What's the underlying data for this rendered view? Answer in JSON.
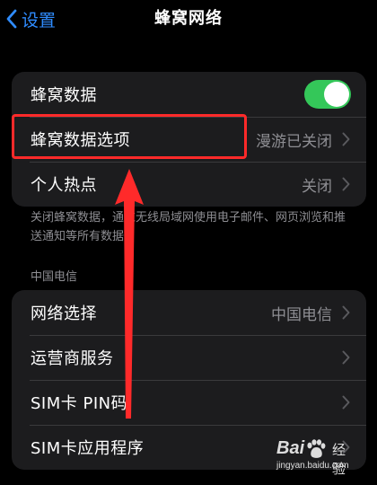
{
  "nav": {
    "back_label": "设置",
    "title": "蜂窝网络"
  },
  "group1": {
    "rows": [
      {
        "label": "蜂窝数据",
        "toggle_on": true
      },
      {
        "label": "蜂窝数据选项",
        "value": "漫游已关闭"
      },
      {
        "label": "个人热点",
        "value": "关闭"
      }
    ]
  },
  "footnote": "关闭蜂窝数据，通过无线局域网使用电子邮件、网页浏览和推送通知等所有数据。",
  "section2": {
    "header": "中国电信",
    "rows": [
      {
        "label": "网络选择",
        "value": "中国电信"
      },
      {
        "label": "运营商服务"
      },
      {
        "label": "SIM卡 PIN码"
      },
      {
        "label": "SIM卡应用程序"
      }
    ]
  },
  "annotation": {
    "highlight_color": "#ff2a2a",
    "arrow_color": "#ff2a2a"
  },
  "watermark": {
    "brand": "Bai",
    "name": "经验",
    "url": "jingyan.baidu.com"
  },
  "colors": {
    "accent": "#2f8cff",
    "toggle_on": "#34c759",
    "cell_bg": "#1c1c1e",
    "secondary_text": "#8e8e93"
  }
}
